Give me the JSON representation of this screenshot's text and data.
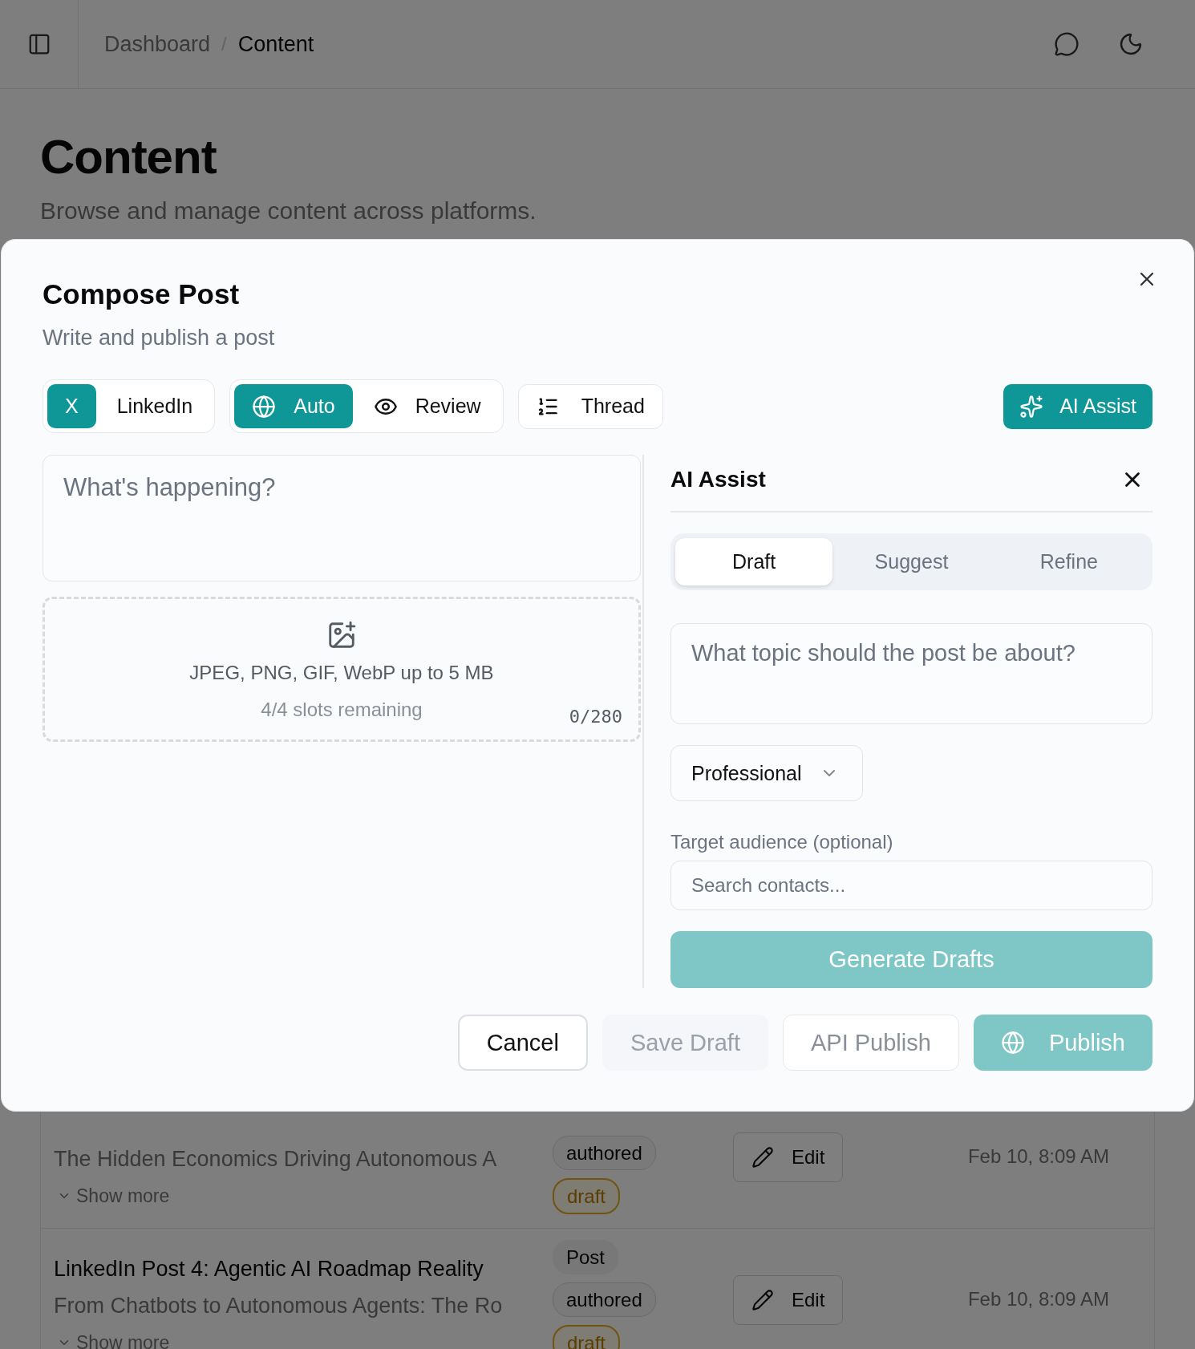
{
  "header": {
    "breadcrumb": [
      {
        "label": "Dashboard",
        "current": false
      },
      {
        "label": "Content",
        "current": true
      }
    ],
    "separator": "/"
  },
  "page": {
    "title": "Content",
    "subtitle": "Browse and manage content across platforms."
  },
  "content_list": {
    "rows": [
      {
        "description": "The Hidden Economics Driving Autonomous A",
        "show_more": "Show more",
        "tags": [
          {
            "label": "authored",
            "kind": "source"
          },
          {
            "label": "draft",
            "kind": "status"
          }
        ],
        "edit": "Edit",
        "date": "Feb 10, 8:09 AM"
      },
      {
        "title": "LinkedIn Post 4: Agentic AI Roadmap Reality",
        "description": "From Chatbots to Autonomous Agents: The Ro",
        "show_more": "Show more",
        "tags": [
          {
            "label": "Post",
            "kind": "type"
          },
          {
            "label": "authored",
            "kind": "source"
          },
          {
            "label": "draft",
            "kind": "status"
          }
        ],
        "edit": "Edit",
        "date": "Feb 10, 8:09 AM"
      }
    ]
  },
  "dialog": {
    "title": "Compose Post",
    "subtitle": "Write and publish a post",
    "platforms": [
      {
        "label": "X",
        "selected": true
      },
      {
        "label": "LinkedIn",
        "selected": false
      }
    ],
    "modes": [
      {
        "label": "Auto",
        "selected": true
      },
      {
        "label": "Review",
        "selected": false
      }
    ],
    "thread_button": "Thread",
    "ai_assist_button": "AI Assist",
    "composer": {
      "placeholder": "What's happening?",
      "upload_hint": "JPEG, PNG, GIF, WebP up to 5 MB",
      "slots": "4/4 slots remaining",
      "counter": "0/280"
    },
    "ai_panel": {
      "title": "AI Assist",
      "tabs": [
        {
          "label": "Draft",
          "selected": true
        },
        {
          "label": "Suggest",
          "selected": false
        },
        {
          "label": "Refine",
          "selected": false
        }
      ],
      "topic_placeholder": "What topic should the post be about?",
      "tone": "Professional",
      "audience_label": "Target audience (optional)",
      "audience_placeholder": "Search contacts...",
      "generate_button": "Generate Drafts"
    },
    "footer_buttons": [
      {
        "label": "Cancel",
        "kind": "secondary"
      },
      {
        "label": "Save Draft",
        "kind": "muted"
      },
      {
        "label": "API Publish",
        "kind": "outline"
      },
      {
        "label": "Publish",
        "kind": "primary"
      }
    ]
  }
}
